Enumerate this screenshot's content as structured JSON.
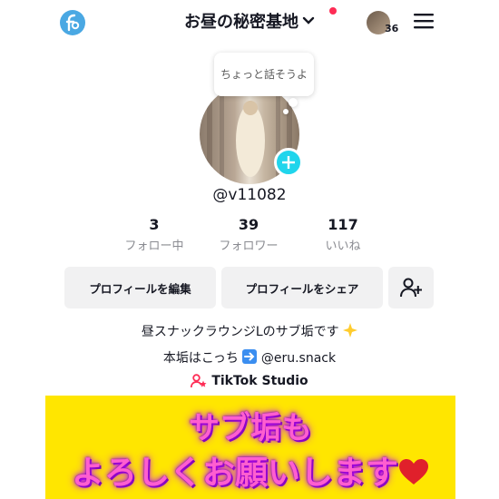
{
  "header": {
    "account_name": "お昼の秘密基地",
    "story_count": "36"
  },
  "profile": {
    "bubble_text": "ちょっと話そうよ",
    "username": "@v11082"
  },
  "stats": [
    {
      "value": "3",
      "label": "フォロー中"
    },
    {
      "value": "39",
      "label": "フォロワー"
    },
    {
      "value": "117",
      "label": "いいね"
    }
  ],
  "actions": {
    "edit_profile": "プロフィールを編集",
    "share_profile": "プロフィールをシェア"
  },
  "bio": {
    "line1": "昼スナックラウンジLのサブ垢です",
    "line2_prefix": "本垢はこっち",
    "line2_handle": "@eru.snack",
    "studio_link": "TikTok Studio"
  },
  "banner": {
    "line1": "サブ垢も",
    "line2": "よろしくお願いします"
  },
  "colors": {
    "accent_pink": "#fe2c55",
    "add_badge": "#20d5ec",
    "banner_bg": "#ffe600",
    "banner_text": "#ff5ed0"
  }
}
